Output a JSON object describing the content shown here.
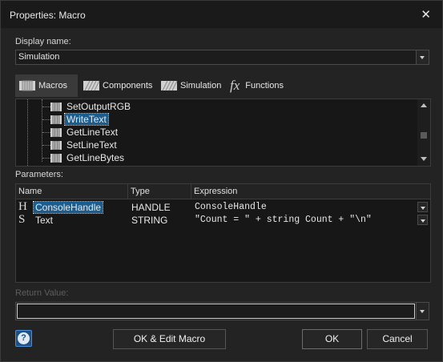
{
  "window": {
    "title": "Properties: Macro"
  },
  "display_name": {
    "label": "Display name:",
    "value": "Simulation"
  },
  "tabs": [
    {
      "label": "Macros",
      "icon": "macro-icon"
    },
    {
      "label": "Components",
      "icon": "components-icon"
    },
    {
      "label": "Simulation",
      "icon": "simulation-icon"
    },
    {
      "label": "Functions",
      "icon": "function-fx-icon",
      "glyph": "fx"
    }
  ],
  "macro_list": {
    "items": [
      {
        "label": "SetOutputRGB",
        "selected": false
      },
      {
        "label": "WriteText",
        "selected": true
      },
      {
        "label": "GetLineText",
        "selected": false
      },
      {
        "label": "SetLineText",
        "selected": false
      },
      {
        "label": "GetLineBytes",
        "selected": false
      }
    ]
  },
  "parameters": {
    "label": "Parameters:",
    "columns": [
      "Name",
      "Type",
      "Expression"
    ],
    "rows": [
      {
        "type_glyph": "H",
        "name": "ConsoleHandle",
        "type": "HANDLE",
        "expression": "ConsoleHandle",
        "selected": true
      },
      {
        "type_glyph": "S",
        "name": "Text",
        "type": "STRING",
        "expression": "\"Count = \" + string Count + \"\\n\"",
        "selected": false
      }
    ]
  },
  "return_value": {
    "label": "Return Value:",
    "value": ""
  },
  "buttons": {
    "help": "?",
    "ok_edit": "OK & Edit Macro",
    "ok": "OK",
    "cancel": "Cancel"
  },
  "colors": {
    "selection": "#1c5d8f",
    "primary_border": "#2f7bc4",
    "background": "#232323"
  }
}
